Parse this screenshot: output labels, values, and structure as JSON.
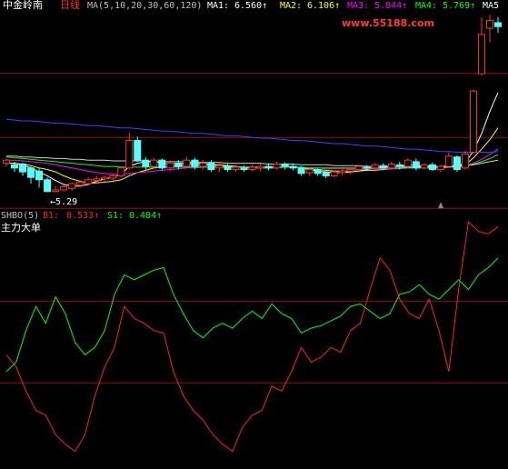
{
  "header": {
    "stock_name": "中金岭南",
    "period": "日线",
    "ma_params": "MA(5,10,20,30,60,120)",
    "ma_values": [
      {
        "label": "MA1:",
        "value": "6.560↑",
        "color": "#ffffff"
      },
      {
        "label": "MA2:",
        "value": "6.106↑",
        "color": "#ffff00"
      },
      {
        "label": "MA3:",
        "value": "5.844↑",
        "color": "#ff00ff"
      },
      {
        "label": "MA4:",
        "value": "5.769↑",
        "color": "#00ff00"
      },
      {
        "label": "MA5",
        "value": "",
        "color": "#ffffff"
      }
    ],
    "watermark": "www.55188.com"
  },
  "price_panel": {
    "low_annotation": "←5.29"
  },
  "indicator_panel": {
    "name": "SHBO(5)",
    "b1_label": "B1:",
    "b1_value": "0.533↑",
    "s1_label": "S1:",
    "s1_value": "0.484↑",
    "subtitle": "主力大单"
  },
  "colors": {
    "background": "#000000",
    "up": "#ff3232",
    "down": "#54ffff",
    "grid": "#8b0000",
    "b1": "#ff2020",
    "s1": "#00ff00"
  },
  "chart_data": [
    {
      "type": "candlestick",
      "title": "",
      "ylim": [
        5.1,
        7.6
      ],
      "candles": [
        [
          5.66,
          5.7,
          5.62,
          5.72
        ],
        [
          5.64,
          5.6,
          5.55,
          5.68
        ],
        [
          5.65,
          5.55,
          5.5,
          5.67
        ],
        [
          5.6,
          5.48,
          5.4,
          5.62
        ],
        [
          5.56,
          5.45,
          5.35,
          5.6
        ],
        [
          5.45,
          5.3,
          5.29,
          5.48
        ],
        [
          5.3,
          5.32,
          5.29,
          5.37
        ],
        [
          5.32,
          5.36,
          5.3,
          5.38
        ],
        [
          5.34,
          5.4,
          5.31,
          5.42
        ],
        [
          5.38,
          5.42,
          5.35,
          5.45
        ],
        [
          5.4,
          5.45,
          5.38,
          5.48
        ],
        [
          5.44,
          5.46,
          5.4,
          5.5
        ],
        [
          5.46,
          5.48,
          5.42,
          5.5
        ],
        [
          5.47,
          5.5,
          5.44,
          5.52
        ],
        [
          5.5,
          5.6,
          5.48,
          5.62
        ],
        [
          5.6,
          5.95,
          5.58,
          6.05
        ],
        [
          5.95,
          5.7,
          5.68,
          6.0
        ],
        [
          5.7,
          5.62,
          5.58,
          5.74
        ],
        [
          5.62,
          5.7,
          5.58,
          5.73
        ],
        [
          5.7,
          5.6,
          5.57,
          5.72
        ],
        [
          5.6,
          5.66,
          5.56,
          5.7
        ],
        [
          5.66,
          5.62,
          5.58,
          5.7
        ],
        [
          5.62,
          5.7,
          5.6,
          5.74
        ],
        [
          5.7,
          5.62,
          5.58,
          5.73
        ],
        [
          5.62,
          5.66,
          5.58,
          5.7
        ],
        [
          5.66,
          5.58,
          5.55,
          5.7
        ],
        [
          5.6,
          5.63,
          5.55,
          5.66
        ],
        [
          5.62,
          5.58,
          5.55,
          5.65
        ],
        [
          5.58,
          5.61,
          5.55,
          5.64
        ],
        [
          5.6,
          5.58,
          5.55,
          5.63
        ],
        [
          5.58,
          5.61,
          5.56,
          5.64
        ],
        [
          5.6,
          5.62,
          5.56,
          5.65
        ],
        [
          5.62,
          5.6,
          5.57,
          5.66
        ],
        [
          5.6,
          5.65,
          5.58,
          5.68
        ],
        [
          5.64,
          5.62,
          5.58,
          5.67
        ],
        [
          5.62,
          5.6,
          5.57,
          5.65
        ],
        [
          5.6,
          5.53,
          5.5,
          5.62
        ],
        [
          5.54,
          5.58,
          5.5,
          5.6
        ],
        [
          5.58,
          5.53,
          5.5,
          5.6
        ],
        [
          5.54,
          5.5,
          5.47,
          5.56
        ],
        [
          5.5,
          5.55,
          5.48,
          5.57
        ],
        [
          5.54,
          5.56,
          5.5,
          5.59
        ],
        [
          5.56,
          5.58,
          5.52,
          5.6
        ],
        [
          5.58,
          5.62,
          5.55,
          5.64
        ],
        [
          5.61,
          5.6,
          5.56,
          5.64
        ],
        [
          5.6,
          5.64,
          5.57,
          5.66
        ],
        [
          5.63,
          5.6,
          5.57,
          5.66
        ],
        [
          5.6,
          5.65,
          5.58,
          5.68
        ],
        [
          5.64,
          5.62,
          5.58,
          5.68
        ],
        [
          5.62,
          5.7,
          5.6,
          5.72
        ],
        [
          5.68,
          5.6,
          5.57,
          5.72
        ],
        [
          5.6,
          5.64,
          5.58,
          5.66
        ],
        [
          5.64,
          5.58,
          5.56,
          5.67
        ],
        [
          5.58,
          5.62,
          5.55,
          5.64
        ],
        [
          5.62,
          5.75,
          5.6,
          5.8
        ],
        [
          5.74,
          5.58,
          5.55,
          5.76
        ],
        [
          5.6,
          5.78,
          5.58,
          5.82
        ],
        [
          5.8,
          6.58,
          5.78,
          6.6
        ],
        [
          6.8,
          7.3,
          6.78,
          7.52
        ],
        [
          7.38,
          7.48,
          7.2,
          7.55
        ],
        [
          7.45,
          7.4,
          7.32,
          7.52
        ]
      ],
      "series": [
        {
          "name": "MA1",
          "color": "#ffffff",
          "values": [
            5.66,
            5.66,
            5.64,
            5.6,
            5.55,
            5.5,
            5.44,
            5.39,
            5.37,
            5.37,
            5.39,
            5.43,
            5.46,
            5.48,
            5.52,
            5.62,
            5.66,
            5.68,
            5.68,
            5.66,
            5.65,
            5.66,
            5.66,
            5.66,
            5.66,
            5.64,
            5.63,
            5.62,
            5.62,
            5.6,
            5.6,
            5.6,
            5.61,
            5.61,
            5.62,
            5.62,
            5.6,
            5.58,
            5.56,
            5.55,
            5.54,
            5.54,
            5.55,
            5.56,
            5.58,
            5.6,
            5.61,
            5.62,
            5.62,
            5.64,
            5.63,
            5.63,
            5.62,
            5.61,
            5.63,
            5.63,
            5.66,
            5.82,
            6.04,
            6.32,
            6.56
          ]
        },
        {
          "name": "MA2",
          "color": "#ffff00",
          "values": [
            5.66,
            5.66,
            5.65,
            5.63,
            5.6,
            5.58,
            5.55,
            5.5,
            5.46,
            5.43,
            5.41,
            5.41,
            5.42,
            5.43,
            5.45,
            5.5,
            5.54,
            5.57,
            5.6,
            5.61,
            5.62,
            5.63,
            5.64,
            5.64,
            5.64,
            5.64,
            5.64,
            5.63,
            5.62,
            5.61,
            5.61,
            5.6,
            5.6,
            5.6,
            5.61,
            5.61,
            5.6,
            5.59,
            5.58,
            5.57,
            5.56,
            5.56,
            5.56,
            5.56,
            5.57,
            5.57,
            5.58,
            5.59,
            5.6,
            5.61,
            5.61,
            5.62,
            5.62,
            5.62,
            5.63,
            5.62,
            5.64,
            5.73,
            5.84,
            5.96,
            6.11
          ]
        },
        {
          "name": "MA3",
          "color": "#ff00ff",
          "values": [
            5.7,
            5.7,
            5.69,
            5.68,
            5.67,
            5.66,
            5.64,
            5.62,
            5.6,
            5.58,
            5.56,
            5.54,
            5.53,
            5.52,
            5.52,
            5.53,
            5.54,
            5.55,
            5.56,
            5.57,
            5.58,
            5.59,
            5.6,
            5.6,
            5.61,
            5.61,
            5.61,
            5.61,
            5.61,
            5.61,
            5.61,
            5.61,
            5.61,
            5.61,
            5.61,
            5.61,
            5.6,
            5.6,
            5.6,
            5.59,
            5.59,
            5.59,
            5.59,
            5.59,
            5.59,
            5.59,
            5.59,
            5.59,
            5.59,
            5.6,
            5.6,
            5.6,
            5.6,
            5.6,
            5.61,
            5.61,
            5.62,
            5.66,
            5.71,
            5.77,
            5.84
          ]
        },
        {
          "name": "MA4",
          "color": "#00ff00",
          "values": [
            5.74,
            5.73,
            5.72,
            5.71,
            5.7,
            5.69,
            5.68,
            5.67,
            5.66,
            5.65,
            5.64,
            5.63,
            5.62,
            5.62,
            5.61,
            5.61,
            5.61,
            5.61,
            5.61,
            5.61,
            5.61,
            5.61,
            5.61,
            5.61,
            5.61,
            5.61,
            5.61,
            5.61,
            5.61,
            5.61,
            5.61,
            5.61,
            5.61,
            5.61,
            5.61,
            5.61,
            5.61,
            5.6,
            5.6,
            5.6,
            5.6,
            5.6,
            5.6,
            5.6,
            5.6,
            5.6,
            5.6,
            5.6,
            5.6,
            5.6,
            5.6,
            5.6,
            5.6,
            5.6,
            5.61,
            5.61,
            5.62,
            5.65,
            5.68,
            5.72,
            5.77
          ]
        },
        {
          "name": "MA5",
          "color": "#d0d0d0",
          "values": [
            5.75,
            5.75,
            5.74,
            5.74,
            5.73,
            5.73,
            5.72,
            5.72,
            5.71,
            5.71,
            5.7,
            5.7,
            5.7,
            5.69,
            5.69,
            5.69,
            5.69,
            5.69,
            5.68,
            5.68,
            5.68,
            5.68,
            5.68,
            5.67,
            5.67,
            5.67,
            5.67,
            5.66,
            5.66,
            5.66,
            5.66,
            5.66,
            5.65,
            5.65,
            5.65,
            5.65,
            5.64,
            5.64,
            5.64,
            5.64,
            5.63,
            5.63,
            5.63,
            5.63,
            5.62,
            5.62,
            5.62,
            5.62,
            5.62,
            5.61,
            5.61,
            5.61,
            5.61,
            5.61,
            5.61,
            5.62,
            5.63,
            5.64,
            5.66,
            5.68,
            5.7
          ]
        },
        {
          "name": "MA6",
          "color": "#4040ff",
          "values": [
            6.22,
            6.21,
            6.2,
            6.2,
            6.19,
            6.18,
            6.17,
            6.17,
            6.16,
            6.15,
            6.14,
            6.14,
            6.13,
            6.12,
            6.11,
            6.11,
            6.1,
            6.09,
            6.08,
            6.07,
            6.07,
            6.06,
            6.05,
            6.04,
            6.04,
            6.03,
            6.02,
            6.01,
            6.01,
            6.0,
            5.99,
            5.98,
            5.98,
            5.97,
            5.96,
            5.95,
            5.95,
            5.94,
            5.93,
            5.92,
            5.91,
            5.91,
            5.9,
            5.89,
            5.88,
            5.88,
            5.87,
            5.86,
            5.85,
            5.84,
            5.84,
            5.83,
            5.82,
            5.81,
            5.81,
            5.8,
            5.8,
            5.8,
            5.8,
            5.8,
            5.81
          ]
        }
      ]
    },
    {
      "type": "line",
      "title": "",
      "ylim": [
        0,
        1
      ],
      "series": [
        {
          "name": "B1",
          "color": "#ff2020",
          "values": [
            0.45,
            0.4,
            0.3,
            0.22,
            0.2,
            0.12,
            0.08,
            0.05,
            0.12,
            0.28,
            0.4,
            0.48,
            0.65,
            0.6,
            0.58,
            0.55,
            0.54,
            0.38,
            0.28,
            0.22,
            0.18,
            0.12,
            0.08,
            0.05,
            0.15,
            0.2,
            0.22,
            0.32,
            0.3,
            0.38,
            0.48,
            0.42,
            0.44,
            0.48,
            0.46,
            0.55,
            0.58,
            0.72,
            0.85,
            0.8,
            0.68,
            0.62,
            0.6,
            0.68,
            0.55,
            0.38,
            0.72,
            1.0,
            0.96,
            0.95,
            0.98
          ]
        },
        {
          "name": "S1",
          "color": "#00ff00",
          "values": [
            0.38,
            0.42,
            0.55,
            0.65,
            0.58,
            0.69,
            0.62,
            0.5,
            0.45,
            0.48,
            0.55,
            0.7,
            0.78,
            0.76,
            0.78,
            0.8,
            0.81,
            0.7,
            0.62,
            0.55,
            0.52,
            0.56,
            0.58,
            0.56,
            0.6,
            0.63,
            0.6,
            0.66,
            0.62,
            0.6,
            0.54,
            0.56,
            0.57,
            0.59,
            0.61,
            0.65,
            0.66,
            0.63,
            0.6,
            0.62,
            0.7,
            0.71,
            0.74,
            0.7,
            0.68,
            0.72,
            0.76,
            0.72,
            0.78,
            0.81,
            0.85
          ]
        }
      ]
    }
  ]
}
